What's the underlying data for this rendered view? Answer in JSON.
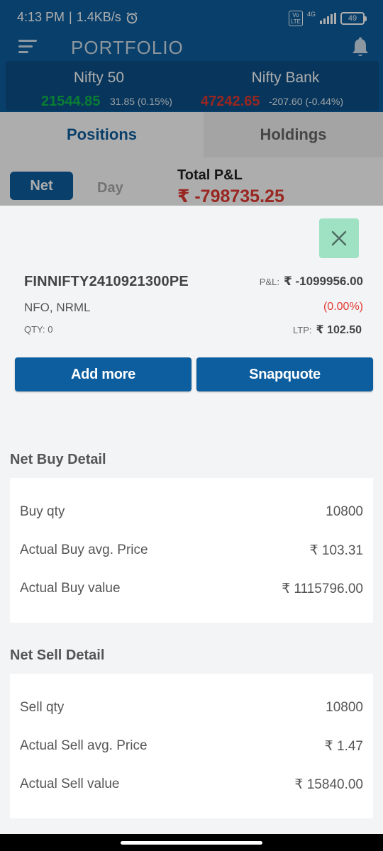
{
  "status_bar": {
    "time": "4:13 PM",
    "separator": "|",
    "speed": "1.4KB/s",
    "alarm_icon": "alarm-icon",
    "volte_top": "Vo",
    "volte_bottom": "LTE",
    "network": "4G",
    "battery": "49"
  },
  "app_bar": {
    "title": "PORTFOLIO",
    "menu_icon": "hamburger-menu-icon",
    "bell_icon": "bell-icon"
  },
  "indices": [
    {
      "name": "Nifty 50",
      "value": "21544.85",
      "change": "31.85 (0.15%)",
      "trend": "up"
    },
    {
      "name": "Nifty Bank",
      "value": "47242.65",
      "change": "-207.60 (-0.44%)",
      "trend": "down"
    }
  ],
  "tabs": [
    {
      "label": "Positions",
      "active": true
    },
    {
      "label": "Holdings",
      "active": false
    }
  ],
  "filters": {
    "net": "Net",
    "day": "Day",
    "total_pnl_label": "Total P&L",
    "total_pnl_value": "₹ -798735.25"
  },
  "sheet": {
    "close_icon": "close-icon",
    "symbol": "FINNIFTY2410921300PE",
    "exchange": "NFO, NRML",
    "qty": "QTY: 0",
    "pnl_label": "P&L:",
    "pnl_value": "₹ -1099956.00",
    "pnl_percent": "(0.00%)",
    "ltp_label": "LTP:",
    "ltp_value": "₹ 102.50",
    "buttons": {
      "add_more": "Add more",
      "snapquote": "Snapquote"
    },
    "buy": {
      "title": "Net Buy Detail",
      "rows": [
        {
          "label": "Buy qty",
          "value": "10800"
        },
        {
          "label": "Actual Buy avg. Price",
          "value": "₹  103.31"
        },
        {
          "label": "Actual Buy value",
          "value": "₹ 1115796.00"
        }
      ]
    },
    "sell": {
      "title": "Net Sell Detail",
      "rows": [
        {
          "label": "Sell qty",
          "value": "10800"
        },
        {
          "label": "Actual Sell avg. Price",
          "value": "₹ 1.47"
        },
        {
          "label": "Actual Sell value",
          "value": "₹  15840.00"
        }
      ]
    }
  },
  "colors": {
    "primary": "#0d5e9e",
    "gain": "#0fb84e",
    "loss": "#e23a32",
    "close_button": "#9fe1c3"
  }
}
